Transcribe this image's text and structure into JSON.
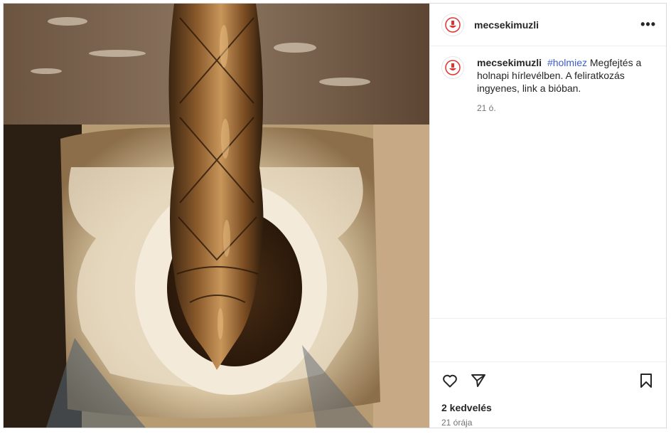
{
  "post": {
    "username": "mecsekimuzli",
    "more_icon": "more-horizontal-icon",
    "caption": {
      "username": "mecsekimuzli",
      "hashtag": "#holmiez",
      "text": "Megfejtés a holnapi hírlevélben. A feliratkozás ingyenes, link a bióban.",
      "time": "21 ó."
    },
    "actions": {
      "like_icon": "heart-icon",
      "share_icon": "paper-plane-icon",
      "save_icon": "bookmark-icon"
    },
    "likes": "2 kedvelés",
    "timestamp": "21 órája"
  },
  "colors": {
    "hashtag": "#3b5cc9",
    "avatar_accent": "#e0342f"
  }
}
